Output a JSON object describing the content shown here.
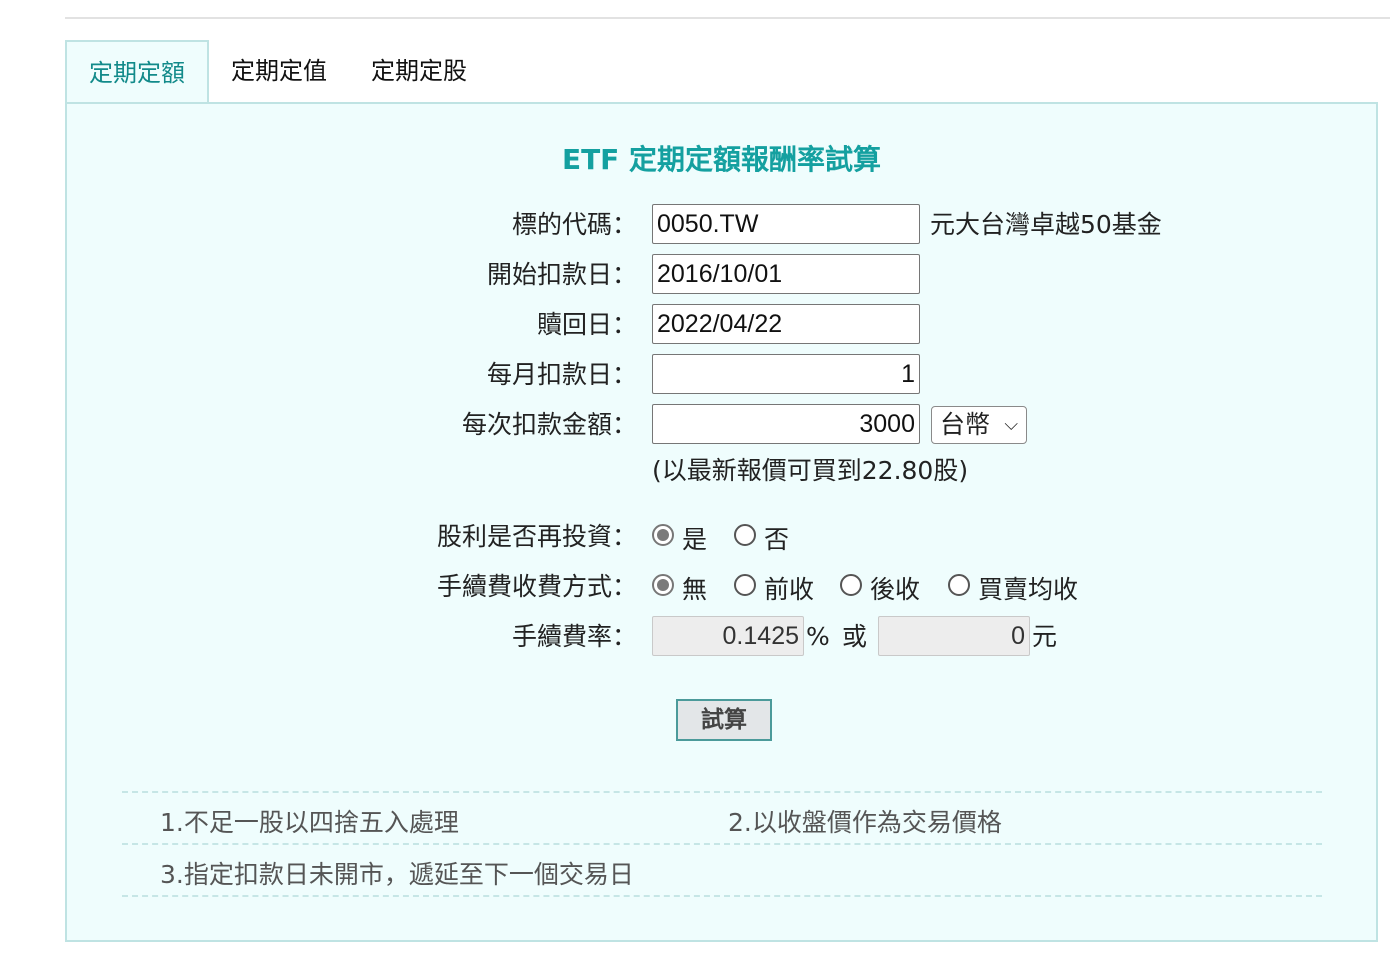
{
  "tabs": [
    {
      "label": "定期定額",
      "active": true
    },
    {
      "label": "定期定值",
      "active": false
    },
    {
      "label": "定期定股",
      "active": false
    }
  ],
  "title": "ETF 定期定額報酬率試算",
  "form": {
    "symbol": {
      "label": "標的代碼：",
      "value": "0050.TW",
      "fund_name": "元大台灣卓越50基金"
    },
    "start_date": {
      "label": "開始扣款日：",
      "value": "2016/10/01"
    },
    "redeem_date": {
      "label": "贖回日：",
      "value": "2022/04/22"
    },
    "monthly_day": {
      "label": "每月扣款日：",
      "value": "1"
    },
    "amount": {
      "label": "每次扣款金額：",
      "value": "3000",
      "currency": "台幣",
      "note": "(以最新報價可買到22.80股)"
    },
    "dividend_reinvest": {
      "label": "股利是否再投資：",
      "options": [
        "是",
        "否"
      ],
      "selected": "是"
    },
    "fee_method": {
      "label": "手續費收費方式：",
      "options": [
        "無",
        "前收",
        "後收",
        "買賣均收"
      ],
      "selected": "無"
    },
    "fee_rate": {
      "label": "手續費率：",
      "percent_value": "0.1425",
      "percent_unit": "%",
      "or_text": "或",
      "fixed_value": "0",
      "fixed_unit": "元"
    }
  },
  "calc_button": "試算",
  "notes": [
    "1.不足一股以四捨五入處理",
    "2.以收盤價作為交易價格",
    "3.指定扣款日未開市，遞延至下一個交易日"
  ],
  "colors": {
    "accent": "#14a0a0",
    "panel_bg": "#effdfd",
    "panel_border": "#bfe3e3"
  }
}
